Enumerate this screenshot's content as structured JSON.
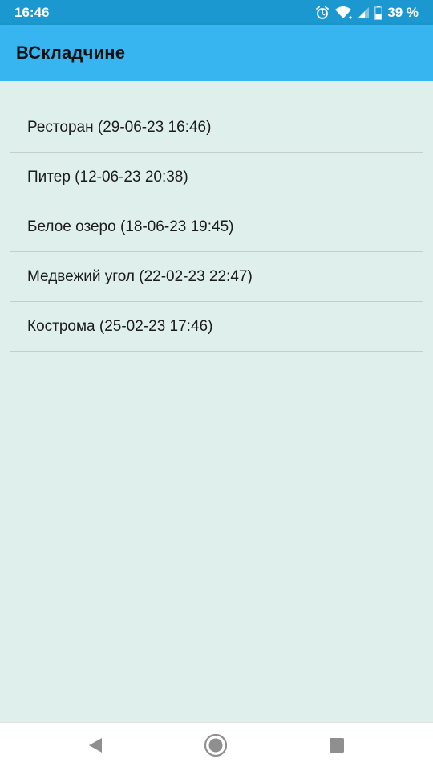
{
  "status_bar": {
    "time": "16:46",
    "battery": "39 %",
    "icons": [
      "alarm-icon",
      "wifi-icon",
      "signal-icon",
      "battery-icon"
    ]
  },
  "app_bar": {
    "title": "ВСкладчине"
  },
  "list": {
    "items": [
      {
        "label": "Ресторан (29-06-23 16:46)"
      },
      {
        "label": "Питер (12-06-23 20:38)"
      },
      {
        "label": "Белое озеро (18-06-23 19:45)"
      },
      {
        "label": "Медвежий угол (22-02-23 22:47)"
      },
      {
        "label": "Кострома (25-02-23 17:46)"
      }
    ]
  },
  "nav_bar": {
    "buttons": [
      "back-icon",
      "home-icon",
      "recents-icon"
    ]
  },
  "colors": {
    "status_bar": "#1a98cf",
    "app_bar": "#36b5f0",
    "background": "#dff0ec",
    "divider": "#c3cfcc"
  }
}
